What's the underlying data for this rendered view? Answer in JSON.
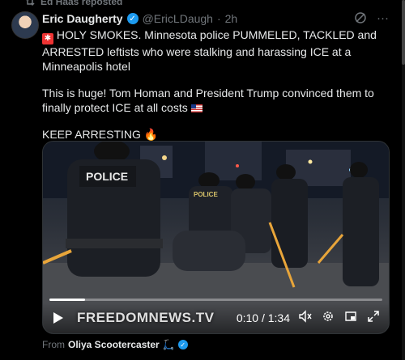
{
  "repost": {
    "label": "Ed Haas reposted",
    "icon": "repost-icon"
  },
  "author": {
    "name": "Eric Daugherty",
    "handle": "@EricLDaugh",
    "separator": "·",
    "time": "2h",
    "verified": true
  },
  "tweet": {
    "line1": "HOLY SMOKES. Minnesota police PUMMELED, TACKLED and ARRESTED leftists who were stalking and harassing ICE at a Minneapolis hotel",
    "line2": "This is huge! Tom Homan and President Trump convinced them to finally protect ICE at all costs",
    "line3": "KEEP ARRESTING"
  },
  "media": {
    "watermark": "FREEDOMNEWS.TV",
    "timecode": "0:10 / 1:34",
    "progress": 0.106,
    "labels": {
      "vest1": "POLICE",
      "vest2": "POLICE"
    }
  },
  "from": {
    "prefix": "From",
    "name": "Oliya Scootercaster",
    "emoji": "🛴"
  },
  "colors": {
    "accent": "#1d9bf0",
    "text": "#e7e9ea",
    "muted": "#71767b",
    "background": "#000000"
  }
}
